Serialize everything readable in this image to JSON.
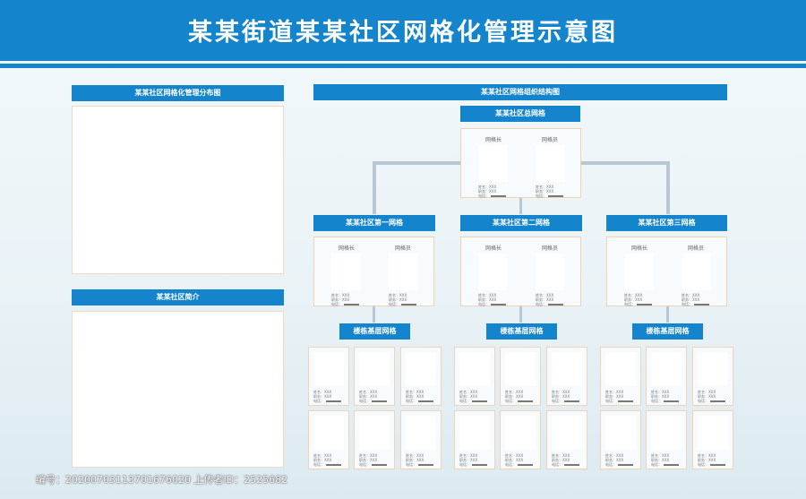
{
  "title": "某某街道某某社区网格化管理示意图",
  "left": {
    "map_title": "某某社区网格化管理分布图",
    "intro_title": "某某社区简介"
  },
  "structure": {
    "title": "某某社区网格组织结构图",
    "root": "某某社区总网格",
    "grid_leader": "网格长",
    "grid_member": "网格员",
    "grid1": "某某社区第一网格",
    "grid2": "某某社区第二网格",
    "grid3": "某某社区第三网格",
    "building_grid": "楼栋基层网格"
  },
  "info": {
    "name": "姓名：XXX",
    "duty": "职务：XXX",
    "phone": "电话："
  },
  "watermark": "编号：20200703113701676020 上传者ID：2525682",
  "colors": {
    "accent": "#1485cc",
    "connector": "#b7c8d3",
    "card_border": "#f0d3b3"
  }
}
